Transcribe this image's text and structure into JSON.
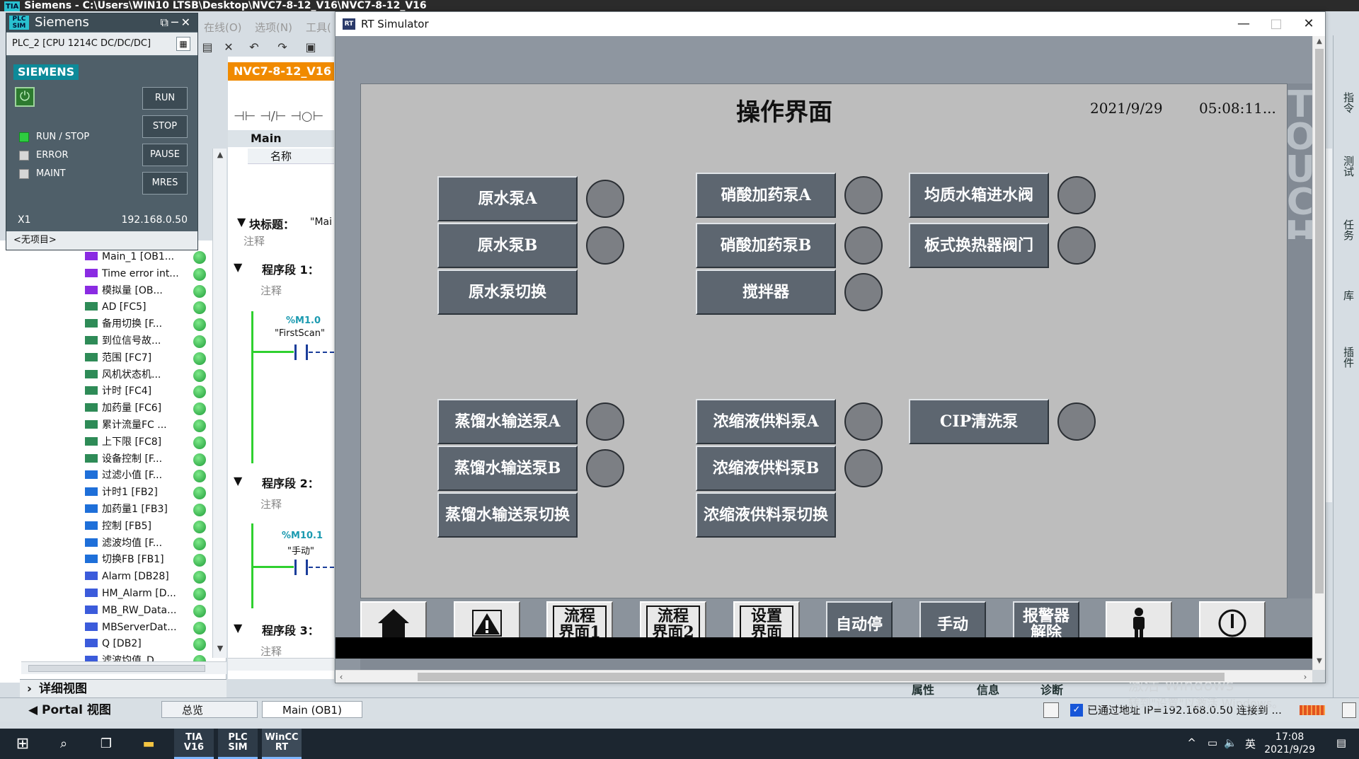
{
  "tia": {
    "title": "Siemens  -  C:\\Users\\WIN10 LTSB\\Desktop\\NVC7-8-12_V16\\NVC7-8-12_V16",
    "title_logo": "TIA",
    "menu": [
      "在线(O)",
      "选项(N)",
      "工具("
    ],
    "editor_tab": "NVC7-8-12_V16",
    "editor_block": "Main",
    "col_name": "名称",
    "block_title_label": "块标题：",
    "block_title_value": "\"Mai",
    "comment": "注释",
    "segments": [
      {
        "label": "程序段 1：",
        "comment": "注释",
        "var": "%M1.0",
        "tag": "\"FirstScan\""
      },
      {
        "label": "程序段 2：",
        "comment": "注释",
        "var": "%M10.1",
        "tag": "\"手动\""
      },
      {
        "label": "程序段 3：",
        "comment": "注释"
      }
    ],
    "tree_items": [
      {
        "label": "Main_1 [OB1...",
        "icon_color": "#8a2be2"
      },
      {
        "label": "Time error int...",
        "icon_color": "#8a2be2"
      },
      {
        "label": "模拟量 [OB...",
        "icon_color": "#8a2be2"
      },
      {
        "label": "AD [FC5]",
        "icon_color": "#2e8b57"
      },
      {
        "label": "备用切换 [F...",
        "icon_color": "#2e8b57"
      },
      {
        "label": "到位信号故...",
        "icon_color": "#2e8b57"
      },
      {
        "label": "范围 [FC7]",
        "icon_color": "#2e8b57"
      },
      {
        "label": "风机状态机...",
        "icon_color": "#2e8b57"
      },
      {
        "label": "计时 [FC4]",
        "icon_color": "#2e8b57"
      },
      {
        "label": "加药量 [FC6]",
        "icon_color": "#2e8b57"
      },
      {
        "label": "累计流量FC ...",
        "icon_color": "#2e8b57"
      },
      {
        "label": "上下限 [FC8]",
        "icon_color": "#2e8b57"
      },
      {
        "label": "设备控制 [F...",
        "icon_color": "#2e8b57"
      },
      {
        "label": "过滤小值 [F...",
        "icon_color": "#1e6fd9"
      },
      {
        "label": "计时1 [FB2]",
        "icon_color": "#1e6fd9"
      },
      {
        "label": "加药量1 [FB3]",
        "icon_color": "#1e6fd9"
      },
      {
        "label": "控制 [FB5]",
        "icon_color": "#1e6fd9"
      },
      {
        "label": "滤波均值 [F...",
        "icon_color": "#1e6fd9"
      },
      {
        "label": "切换FB [FB1]",
        "icon_color": "#1e6fd9"
      },
      {
        "label": "Alarm [DB28]",
        "icon_color": "#3b5bdb"
      },
      {
        "label": "HM_Alarm [D...",
        "icon_color": "#3b5bdb"
      },
      {
        "label": "MB_RW_Data...",
        "icon_color": "#3b5bdb"
      },
      {
        "label": "MBServerDat...",
        "icon_color": "#3b5bdb"
      },
      {
        "label": "Q [DB2]",
        "icon_color": "#3b5bdb"
      },
      {
        "label": "滤波均值_D...",
        "icon_color": "#3b5bdb"
      }
    ],
    "detail_view": "详细视图",
    "portal_view": "Portal 视图",
    "bottom_tabs": [
      "总览",
      "Main (OB1)"
    ],
    "status": "已通过地址 IP=192.168.0.50 连接到 ...",
    "inspector_tabs": [
      "属性",
      "信息",
      "诊断"
    ],
    "task_tabs": [
      "指令",
      "测试",
      "任务",
      "库",
      "插件"
    ]
  },
  "plcsim": {
    "title": "Siemens",
    "logo": "PLC SIM",
    "cpu": "PLC_2 [CPU 1214C DC/DC/DC]",
    "brand": "SIEMENS",
    "leds": [
      {
        "label": "RUN / STOP",
        "on": true
      },
      {
        "label": "ERROR",
        "on": false
      },
      {
        "label": "MAINT",
        "on": false
      }
    ],
    "buttons": [
      "RUN",
      "STOP",
      "PAUSE",
      "MRES"
    ],
    "interface": "X1",
    "ip": "192.168.0.50",
    "project": "<无项目>"
  },
  "rtsim": {
    "title": "RT Simulator",
    "icon": "RT",
    "win_buttons": [
      "—",
      "□",
      "✕"
    ]
  },
  "hmi": {
    "title": "操作界面",
    "date": "2021/9/29",
    "time": "05:08:11...",
    "logo": "TOUCH",
    "buttons": [
      {
        "label": "原水泵A",
        "lamp": true
      },
      {
        "label": "原水泵B",
        "lamp": true
      },
      {
        "label": "原水泵切换",
        "lamp": false
      },
      {
        "label": "硝酸加药泵A",
        "lamp": true
      },
      {
        "label": "硝酸加药泵B",
        "lamp": true
      },
      {
        "label": "搅拌器",
        "lamp": true
      },
      {
        "label": "均质水箱进水阀",
        "lamp": true
      },
      {
        "label": "板式换热器阀门",
        "lamp": true
      },
      {
        "label": "蒸馏水输送泵A",
        "lamp": true
      },
      {
        "label": "蒸馏水输送泵B",
        "lamp": true
      },
      {
        "label": "蒸馏水输送泵切换",
        "lamp": false
      },
      {
        "label": "浓缩液供料泵A",
        "lamp": true
      },
      {
        "label": "浓缩液供料泵B",
        "lamp": true
      },
      {
        "label": "浓缩液供料泵切换",
        "lamp": false
      },
      {
        "label": "CIP清洗泵",
        "lamp": true
      }
    ],
    "lamp_color": "#7c7f84",
    "nav": [
      {
        "label": "",
        "icon": "home-icon"
      },
      {
        "label": "",
        "icon": "alarm-warning-icon"
      },
      {
        "label": "流程界面1"
      },
      {
        "label": "流程界面2"
      },
      {
        "label": "设置界面"
      },
      {
        "label": "自动停"
      },
      {
        "label": "手动"
      },
      {
        "label": "报警器解除"
      },
      {
        "label": "",
        "icon": "user-icon"
      },
      {
        "label": "",
        "icon": "power-icon"
      }
    ]
  },
  "watermark": {
    "line1": "激活 Windows",
    "line2": "转到\"设置\"以激活 Windows。"
  },
  "taskbar": {
    "apps": [
      "TIA V16",
      "PLC SIM",
      "WinCC RT"
    ],
    "time": "17:08",
    "date": "2021/9/29",
    "ime": "英"
  }
}
